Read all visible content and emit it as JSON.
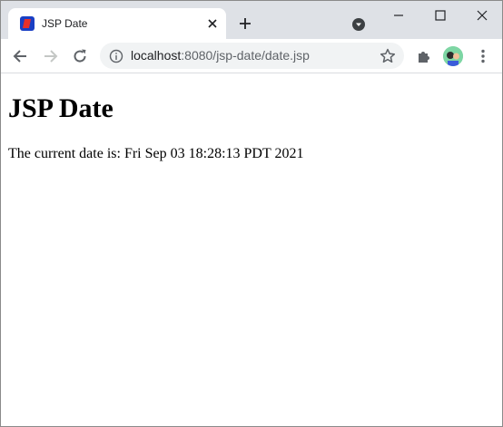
{
  "tab": {
    "title": "JSP Date",
    "favicon": "jsp-favicon"
  },
  "address_bar": {
    "host": "localhost",
    "path": ":8080/jsp-date/date.jsp"
  },
  "page": {
    "heading": "JSP Date",
    "text": "The current date is: Fri Sep 03 18:28:13 PDT 2021"
  },
  "icons": {
    "back": "arrow-left-icon",
    "forward": "arrow-right-icon",
    "reload": "reload-icon",
    "site_info": "info-icon",
    "bookmark": "star-icon",
    "extensions": "puzzle-icon",
    "profile": "avatar",
    "menu": "three-dots-icon",
    "window_minimize": "minimize-icon",
    "window_maximize": "maximize-icon",
    "window_close": "close-icon"
  },
  "colors": {
    "tab_strip": "#dee1e6",
    "omnibox": "#f1f3f4",
    "favicon_blue": "#1a3fc4",
    "favicon_red": "#e8302a"
  }
}
